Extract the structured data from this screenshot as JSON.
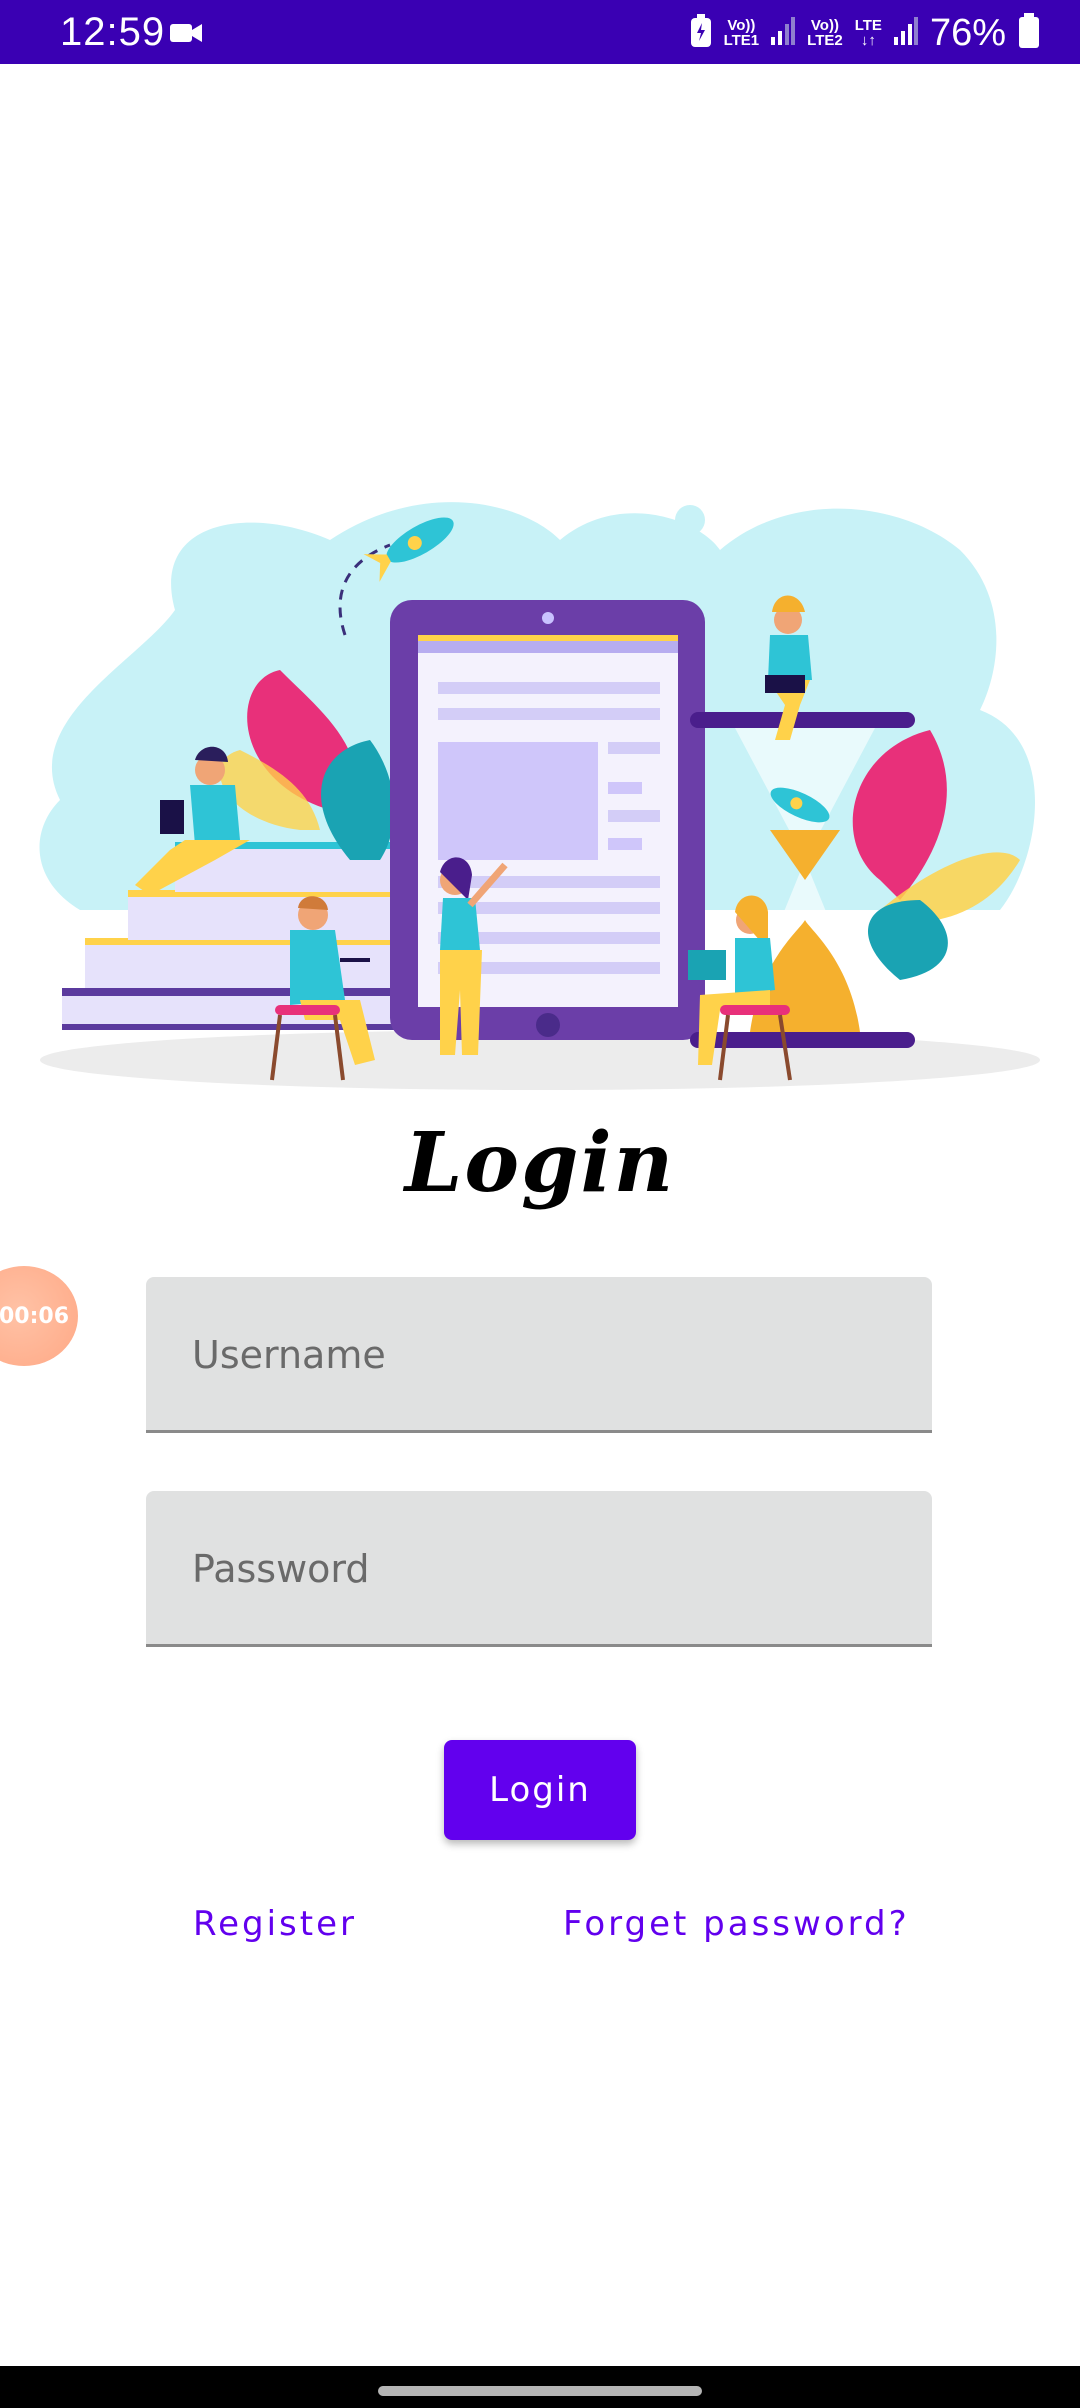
{
  "status_bar": {
    "time": "12:59",
    "sim1_label_top": "Vo))",
    "sim1_label_bottom": "LTE1",
    "sim2_label_top": "Vo))",
    "sim2_label_bottom": "LTE2",
    "lte_label": "LTE",
    "battery_percent": "76%",
    "icons": [
      "video-camera-icon",
      "battery-saver-icon",
      "signal-icon",
      "signal-icon",
      "battery-icon"
    ]
  },
  "login": {
    "title": "Login",
    "username_placeholder": "Username",
    "password_placeholder": "Password",
    "login_button": "Login",
    "register_link": "Register",
    "forgot_link": "Forget password?"
  },
  "overlay": {
    "timer": "00:06"
  },
  "colors": {
    "status_bar": "#3a00b3",
    "primary": "#6200ee",
    "field_bg": "#e0e1e1"
  }
}
